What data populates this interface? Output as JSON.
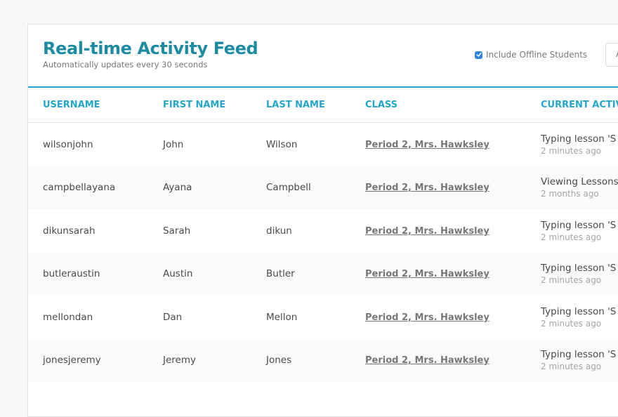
{
  "header": {
    "title": "Real-time Activity Feed",
    "subtitle": "Automatically updates every 30 seconds",
    "include_offline_label": "Include Offline Students",
    "include_offline_checked": true,
    "right_button_label": "A"
  },
  "colors": {
    "accent": "#1fa8cb",
    "title": "#1d8ba2",
    "checkbox": "#2f86e0"
  },
  "table": {
    "columns": [
      "USERNAME",
      "FIRST NAME",
      "LAST NAME",
      "CLASS",
      "CURRENT ACTIV"
    ],
    "rows": [
      {
        "username": "wilsonjohn",
        "first": "John",
        "last": "Wilson",
        "class": "Period 2, Mrs. Hawksley",
        "activity": "Typing lesson 'S",
        "ago": "2 minutes ago"
      },
      {
        "username": "campbellayana",
        "first": "Ayana",
        "last": "Campbell",
        "class": "Period 2, Mrs. Hawksley",
        "activity": "Viewing Lessons",
        "ago": "2 months ago"
      },
      {
        "username": "dikunsarah",
        "first": "Sarah",
        "last": "dikun",
        "class": "Period 2, Mrs. Hawksley",
        "activity": "Typing lesson 'S",
        "ago": "2 minutes ago"
      },
      {
        "username": "butleraustin",
        "first": "Austin",
        "last": "Butler",
        "class": "Period 2, Mrs. Hawksley",
        "activity": "Typing lesson 'S",
        "ago": "2 minutes ago"
      },
      {
        "username": "mellondan",
        "first": "Dan",
        "last": "Mellon",
        "class": "Period 2, Mrs. Hawksley",
        "activity": "Typing lesson 'S",
        "ago": "2 minutes ago"
      },
      {
        "username": "jonesjeremy",
        "first": "Jeremy",
        "last": "Jones",
        "class": "Period 2, Mrs. Hawksley",
        "activity": "Typing lesson 'S",
        "ago": "2 minutes ago"
      }
    ]
  }
}
